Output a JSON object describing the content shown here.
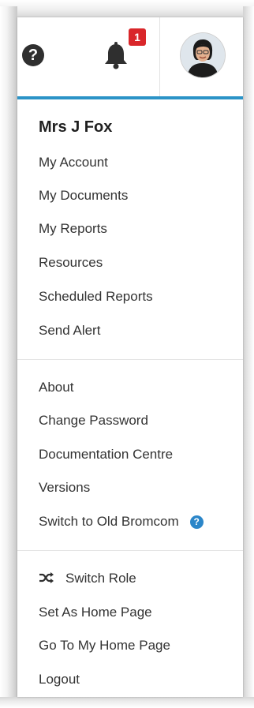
{
  "topbar": {
    "help_glyph": "?",
    "notifications_count": "1",
    "icons": [
      "help-icon",
      "bell-icon",
      "user-avatar"
    ]
  },
  "colors": {
    "accent": "#2b93c7",
    "badge": "#d9262a",
    "info": "#2b86c9"
  },
  "user": {
    "name": "Mrs J Fox"
  },
  "menu": {
    "group1": [
      "My Account",
      "My Documents",
      "My Reports",
      "Resources",
      "Scheduled Reports",
      "Send Alert"
    ],
    "group2": [
      "About",
      "Change Password",
      "Documentation Centre",
      "Versions",
      "Switch to Old Bromcom"
    ],
    "group2_info_glyph": "?",
    "group3": [
      "Switch Role",
      "Set As Home Page",
      "Go To My Home Page",
      "Logout"
    ]
  }
}
